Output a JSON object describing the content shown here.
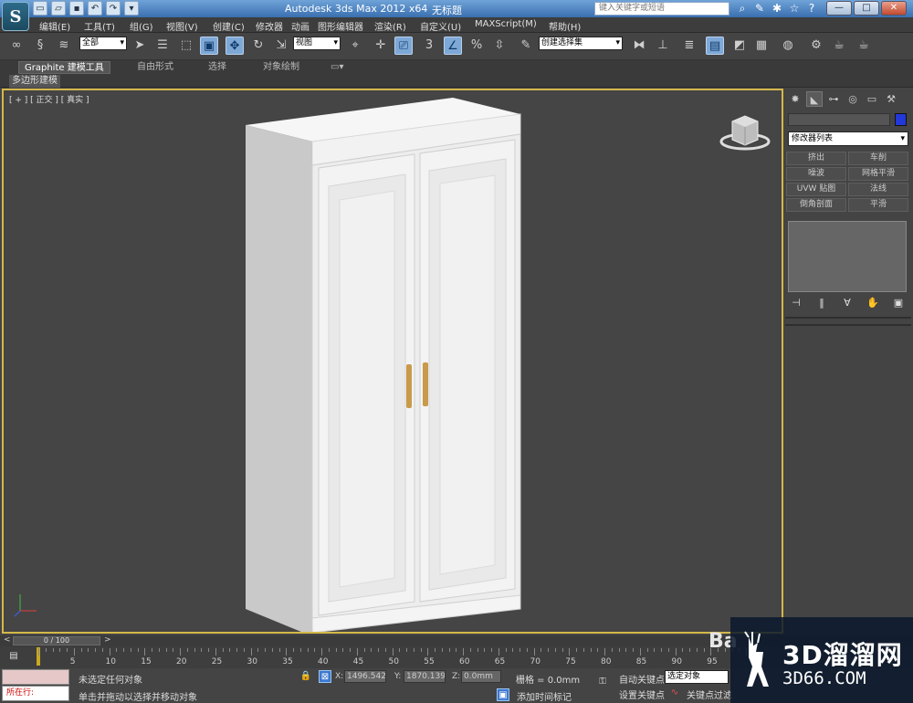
{
  "window": {
    "app_title": "Autodesk 3ds Max  2012 x64",
    "file_name": "无标题",
    "search_placeholder": "键入关键字或短语",
    "minimize": "—",
    "restore": "□",
    "close": "✕"
  },
  "menu": {
    "items": [
      "编辑(E)",
      "工具(T)",
      "组(G)",
      "视图(V)",
      "创建(C)",
      "修改器",
      "动画",
      "图形编辑器",
      "渲染(R)",
      "自定义(U)",
      "MAXScript(M)",
      "帮助(H)"
    ]
  },
  "toolbar": {
    "selection_filter": "全部",
    "ref_coord": "视图",
    "named_selection": "创建选择集",
    "snap_label": "3",
    "percent_snap": "%"
  },
  "ribbon": {
    "tabs": [
      "Graphite 建模工具",
      "自由形式",
      "选择",
      "对象绘制"
    ],
    "sub_label": "多边形建模"
  },
  "viewport": {
    "label": "[ + ] [ 正交 ] [ 真实 ]",
    "model_colors": {
      "front": "#ececec",
      "side": "#c8c8c8",
      "top": "#f7f7f7",
      "handle": "#c89a4a"
    }
  },
  "command_panel": {
    "modifier_list": "修改器列表",
    "modifier_buttons": [
      "挤出",
      "车削",
      "噪波",
      "网格平滑",
      "UVW 贴图",
      "法线",
      "倒角剖面",
      "平滑"
    ],
    "object_color": "#2238d9"
  },
  "timeline": {
    "frame_display": "0 / 100",
    "ticks": [
      "0",
      "5",
      "10",
      "15",
      "20",
      "25",
      "30",
      "35",
      "40",
      "45",
      "50",
      "55",
      "60",
      "65",
      "70",
      "75",
      "80",
      "85",
      "90",
      "95"
    ]
  },
  "status": {
    "maxscript_text": "所在行:",
    "selection_status": "未选定任何对象",
    "prompt": "单击并拖动以选择并移动对象",
    "x_label": "X:",
    "x_value": "1496.542m",
    "y_label": "Y:",
    "y_value": "1870.139m",
    "z_label": "Z:",
    "z_value": "0.0mm",
    "grid": "栅格 = 0.0mm",
    "auto_key": "自动关键点",
    "key_mode": "选定对象",
    "set_key": "设置关键点",
    "key_filter": "关键点过滤",
    "add_time_tag": "添加时间标记"
  },
  "watermark": {
    "text1": "3D溜溜网",
    "text2": "3D66.COM",
    "baidu": "Ba"
  }
}
